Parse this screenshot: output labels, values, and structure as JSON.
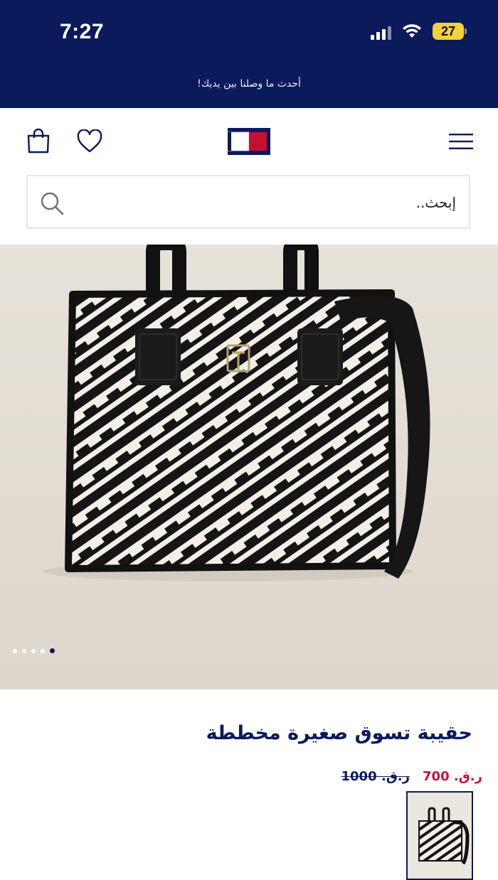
{
  "status_bar": {
    "time": "7:27",
    "battery": "27"
  },
  "promo": {
    "text": "أحدث ما وصلنا بين يديك!"
  },
  "header": {
    "icons": [
      "menu-icon",
      "brand-logo",
      "heart-icon",
      "shopping-bag-icon"
    ]
  },
  "search": {
    "placeholder": "إبحث.."
  },
  "product": {
    "title": "حقيبة تسوق صغيرة مخططة",
    "price_current": "ر.ق. 700",
    "price_original": "ر.ق. 1000"
  },
  "gallery": {
    "dots": 5,
    "active_index": 4
  },
  "colors": {
    "navy": "#0b1a5b",
    "red": "#c0143c",
    "hero_bg": "#e7e2d9",
    "battery": "#f2d23c"
  }
}
